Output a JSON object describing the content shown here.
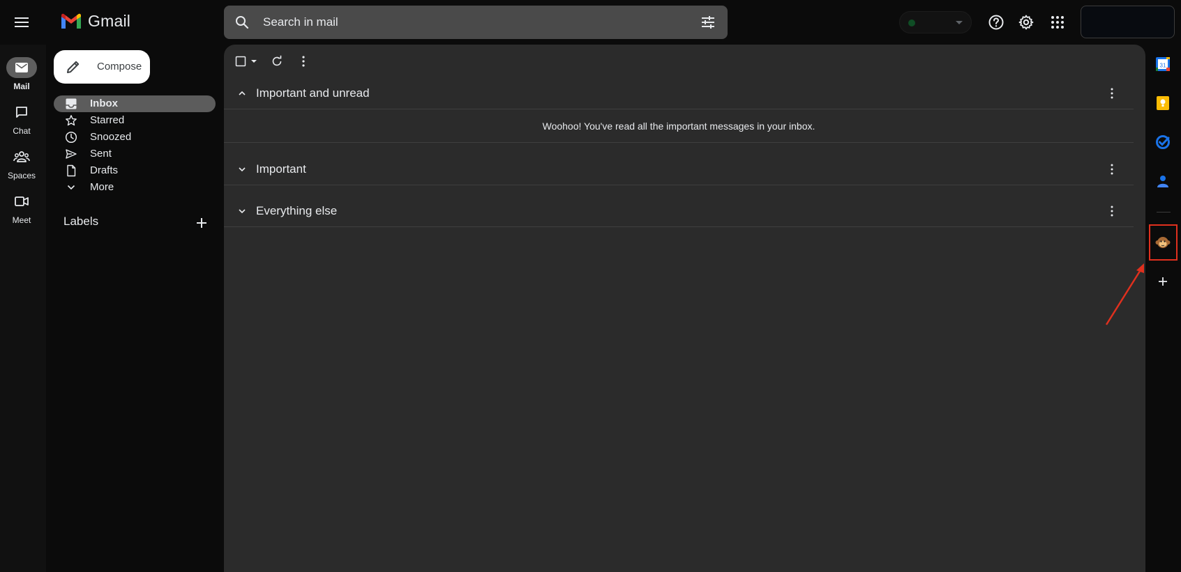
{
  "header": {
    "app_name": "Gmail",
    "search_placeholder": "Search in mail"
  },
  "rail": {
    "items": [
      {
        "label": "Mail",
        "active": true
      },
      {
        "label": "Chat",
        "active": false
      },
      {
        "label": "Spaces",
        "active": false
      },
      {
        "label": "Meet",
        "active": false
      }
    ]
  },
  "nav": {
    "compose_label": "Compose",
    "items": [
      {
        "label": "Inbox",
        "icon": "inbox-icon",
        "active": true
      },
      {
        "label": "Starred",
        "icon": "star-icon"
      },
      {
        "label": "Snoozed",
        "icon": "clock-icon"
      },
      {
        "label": "Sent",
        "icon": "send-icon"
      },
      {
        "label": "Drafts",
        "icon": "draft-icon"
      },
      {
        "label": "More",
        "icon": "chevron-down-icon"
      }
    ],
    "labels_title": "Labels"
  },
  "sections": [
    {
      "title": "Important and unread",
      "expanded": true,
      "message": "Woohoo! You've read all the important messages in your inbox."
    },
    {
      "title": "Important",
      "expanded": false
    },
    {
      "title": "Everything else",
      "expanded": false
    }
  ],
  "side_panel": {
    "icons": [
      "calendar-icon",
      "keep-icon",
      "tasks-icon",
      "contacts-icon",
      "monkey-addon-icon",
      "add-icon"
    ]
  },
  "colors": {
    "accent_highlight": "#e0301e",
    "main_bg": "#2b2b2b",
    "active_nav": "#5c5c5c"
  }
}
